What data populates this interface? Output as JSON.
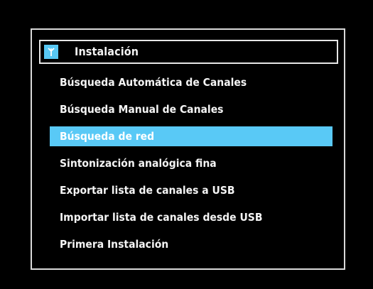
{
  "header": {
    "icon": "antenna-icon",
    "title": "Instalación"
  },
  "menu": {
    "items": [
      {
        "label": "Búsqueda Automática de Canales",
        "selected": false
      },
      {
        "label": "Búsqueda Manual de Canales",
        "selected": false
      },
      {
        "label": "Búsqueda de red",
        "selected": true
      },
      {
        "label": "Sintonización analógica fina",
        "selected": false
      },
      {
        "label": "Exportar lista de canales a USB",
        "selected": false
      },
      {
        "label": "Importar lista de canales desde USB",
        "selected": false
      },
      {
        "label": "Primera Instalación",
        "selected": false
      }
    ]
  },
  "colors": {
    "background": "#000000",
    "frame_border": "#d9d9d9",
    "highlight": "#59c9f6",
    "text": "#f4f4f4"
  }
}
